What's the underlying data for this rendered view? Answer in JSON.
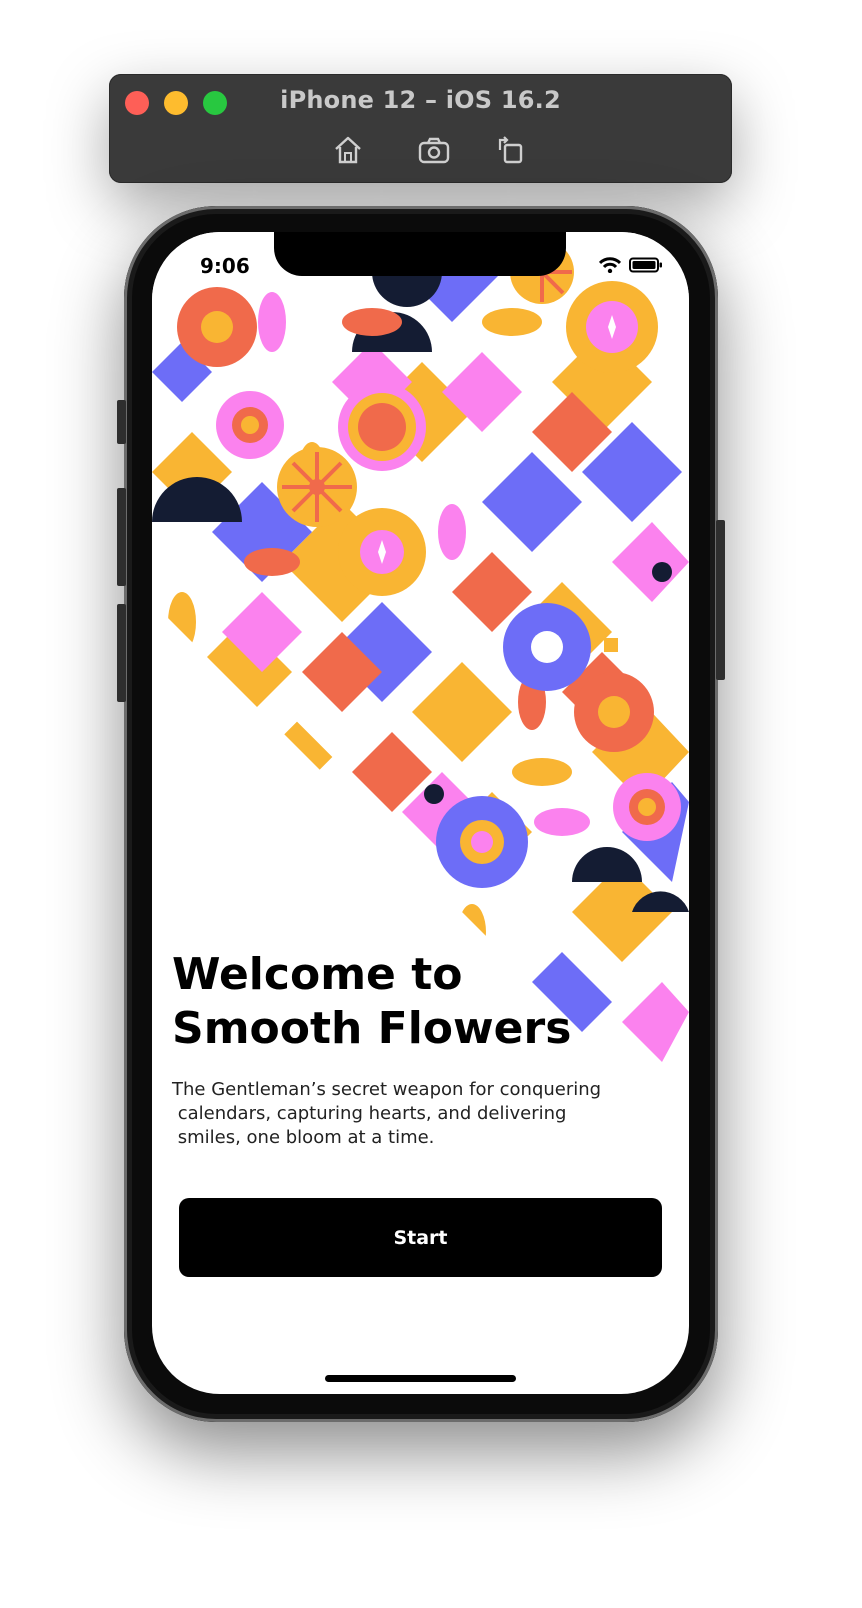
{
  "simulator": {
    "title": "iPhone 12 – iOS 16.2",
    "toolbar": [
      "home-icon",
      "screenshot-icon",
      "rotate-icon"
    ]
  },
  "status_bar": {
    "time": "9:06"
  },
  "welcome": {
    "title_line1": "Welcome to",
    "title_line2": "Smooth Flowers",
    "subtitle_line1": "The Gentleman’s secret weapon for conquering",
    "subtitle_line2": " calendars, capturing hearts, and delivering",
    "subtitle_line3": " smiles, one bloom at a time."
  },
  "start_button": {
    "label": "Start"
  },
  "colors": {
    "yellow": "#f9b533",
    "orange": "#f06a4b",
    "pink": "#fb82ee",
    "purple": "#6d6df7",
    "navy": "#141c33"
  }
}
